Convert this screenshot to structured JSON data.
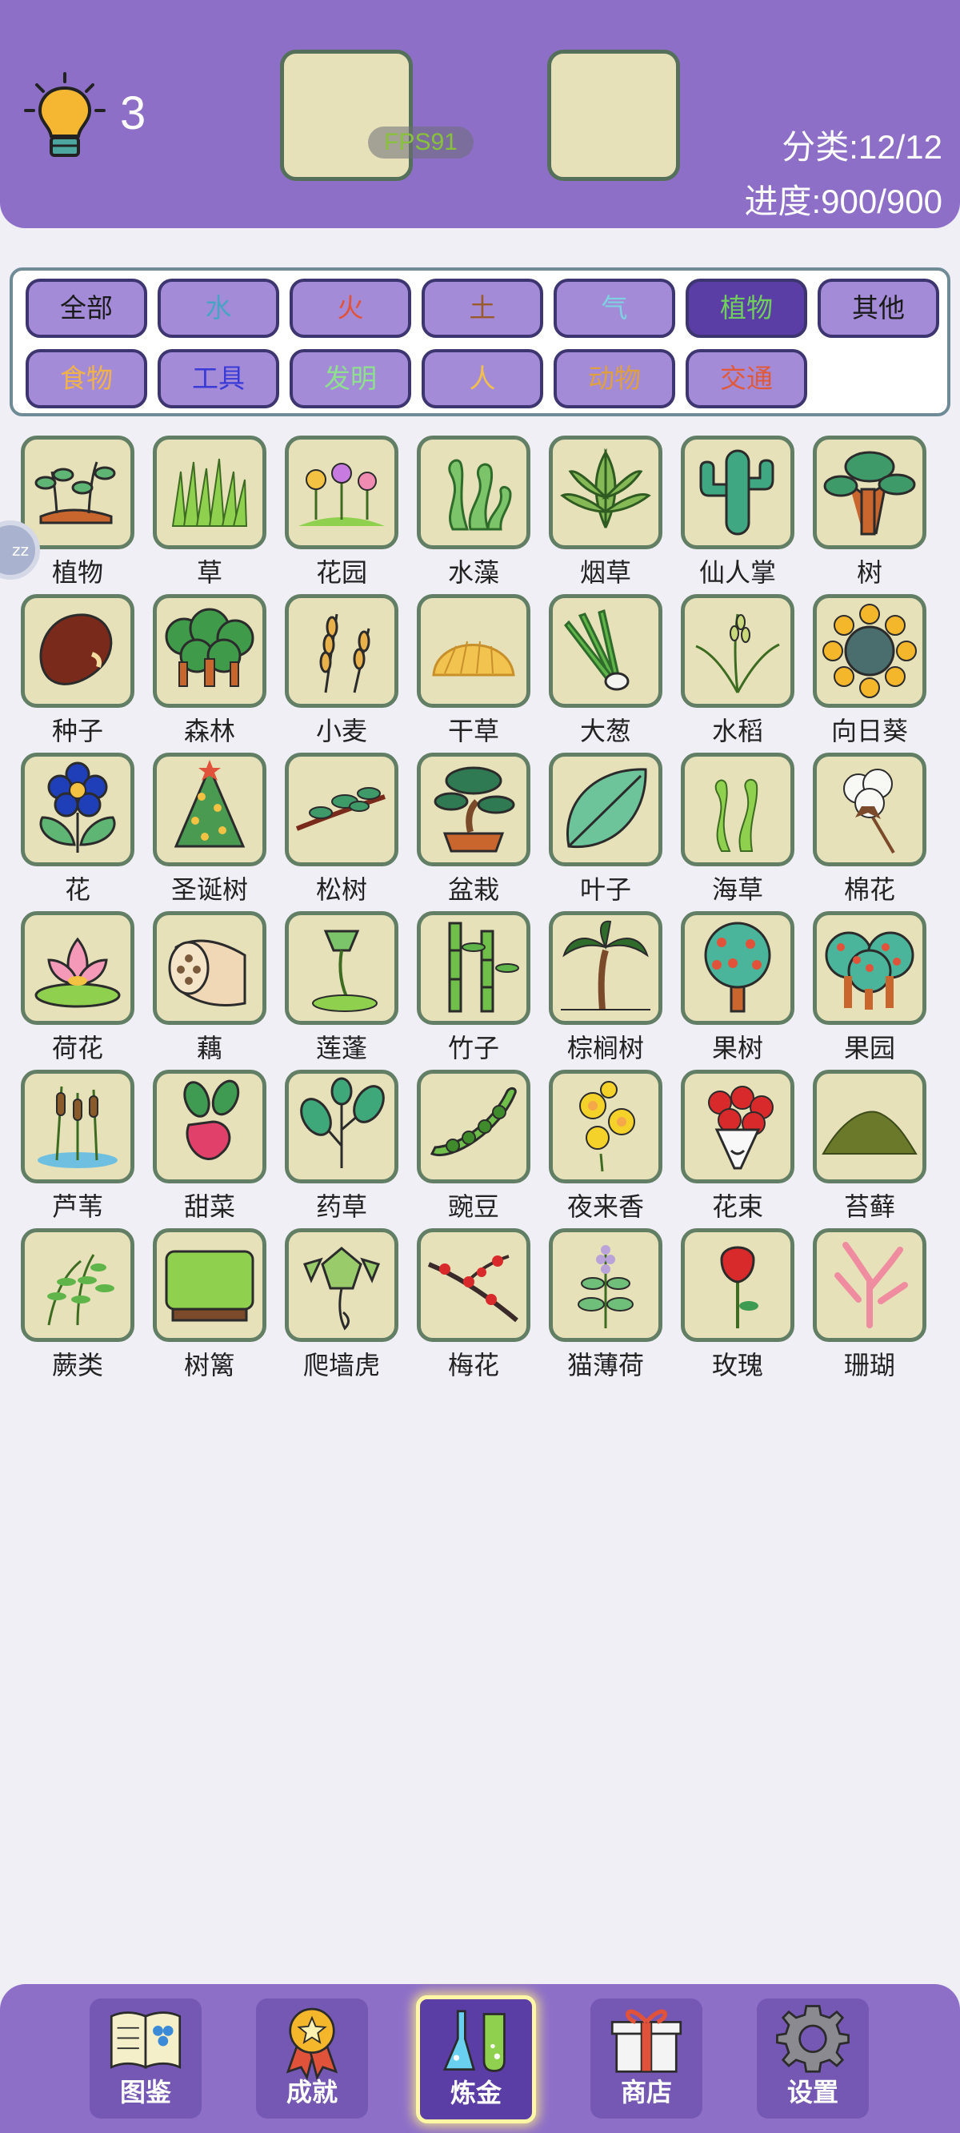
{
  "header": {
    "hint_count": "3",
    "fps": "FPS91",
    "category_stat": "分类:12/12",
    "progress_stat": "进度:900/900"
  },
  "filters": [
    {
      "label": "全部",
      "color": "#1a1a1a",
      "active": false
    },
    {
      "label": "水",
      "color": "#49a3c4",
      "active": false
    },
    {
      "label": "火",
      "color": "#e0533a",
      "active": false
    },
    {
      "label": "土",
      "color": "#9a5b2a",
      "active": false
    },
    {
      "label": "气",
      "color": "#7ed1e0",
      "active": false
    },
    {
      "label": "植物",
      "color": "#6fce5d",
      "active": true
    },
    {
      "label": "其他",
      "color": "#1a1a1a",
      "active": false
    },
    {
      "label": "食物",
      "color": "#f2b24a",
      "active": false
    },
    {
      "label": "工具",
      "color": "#3a3ad6",
      "active": false
    },
    {
      "label": "发明",
      "color": "#8ee08e",
      "active": false
    },
    {
      "label": "人",
      "color": "#f2c04a",
      "active": false
    },
    {
      "label": "动物",
      "color": "#e0a040",
      "active": false
    },
    {
      "label": "交通",
      "color": "#e05a3a",
      "active": false
    }
  ],
  "items": [
    {
      "label": "植物",
      "icon": "sprouts-icon"
    },
    {
      "label": "草",
      "icon": "grass-icon"
    },
    {
      "label": "花园",
      "icon": "garden-icon"
    },
    {
      "label": "水藻",
      "icon": "algae-icon"
    },
    {
      "label": "烟草",
      "icon": "tobacco-leaf-icon"
    },
    {
      "label": "仙人掌",
      "icon": "cactus-icon"
    },
    {
      "label": "树",
      "icon": "tree-icon"
    },
    {
      "label": "种子",
      "icon": "seed-icon"
    },
    {
      "label": "森林",
      "icon": "forest-icon"
    },
    {
      "label": "小麦",
      "icon": "wheat-icon"
    },
    {
      "label": "干草",
      "icon": "hay-icon"
    },
    {
      "label": "大葱",
      "icon": "scallion-icon"
    },
    {
      "label": "水稻",
      "icon": "rice-icon"
    },
    {
      "label": "向日葵",
      "icon": "sunflower-icon"
    },
    {
      "label": "花",
      "icon": "flower-icon"
    },
    {
      "label": "圣诞树",
      "icon": "christmas-tree-icon"
    },
    {
      "label": "松树",
      "icon": "pine-branch-icon"
    },
    {
      "label": "盆栽",
      "icon": "bonsai-icon"
    },
    {
      "label": "叶子",
      "icon": "leaf-icon"
    },
    {
      "label": "海草",
      "icon": "seaweed-icon"
    },
    {
      "label": "棉花",
      "icon": "cotton-icon"
    },
    {
      "label": "荷花",
      "icon": "lotus-icon"
    },
    {
      "label": "藕",
      "icon": "lotus-root-icon"
    },
    {
      "label": "莲蓬",
      "icon": "lotus-pod-icon"
    },
    {
      "label": "竹子",
      "icon": "bamboo-icon"
    },
    {
      "label": "棕榈树",
      "icon": "palm-tree-icon"
    },
    {
      "label": "果树",
      "icon": "fruit-tree-icon"
    },
    {
      "label": "果园",
      "icon": "orchard-icon"
    },
    {
      "label": "芦苇",
      "icon": "reed-icon"
    },
    {
      "label": "甜菜",
      "icon": "beet-icon"
    },
    {
      "label": "药草",
      "icon": "herb-icon"
    },
    {
      "label": "豌豆",
      "icon": "pea-icon"
    },
    {
      "label": "夜来香",
      "icon": "yellow-flowers-icon"
    },
    {
      "label": "花束",
      "icon": "bouquet-icon"
    },
    {
      "label": "苔藓",
      "icon": "moss-icon"
    },
    {
      "label": "蕨类",
      "icon": "fern-icon"
    },
    {
      "label": "树篱",
      "icon": "hedge-icon"
    },
    {
      "label": "爬墙虎",
      "icon": "ivy-icon"
    },
    {
      "label": "梅花",
      "icon": "plum-blossom-icon"
    },
    {
      "label": "猫薄荷",
      "icon": "catnip-icon"
    },
    {
      "label": "玫瑰",
      "icon": "rose-icon"
    },
    {
      "label": "珊瑚",
      "icon": "coral-icon"
    }
  ],
  "nav": [
    {
      "label": "图鉴",
      "icon": "book-icon",
      "active": false
    },
    {
      "label": "成就",
      "icon": "medal-icon",
      "active": false
    },
    {
      "label": "炼金",
      "icon": "flask-icon",
      "active": true
    },
    {
      "label": "商店",
      "icon": "gift-icon",
      "active": false
    },
    {
      "label": "设置",
      "icon": "gear-icon",
      "active": false
    }
  ],
  "side_handle": "zz"
}
